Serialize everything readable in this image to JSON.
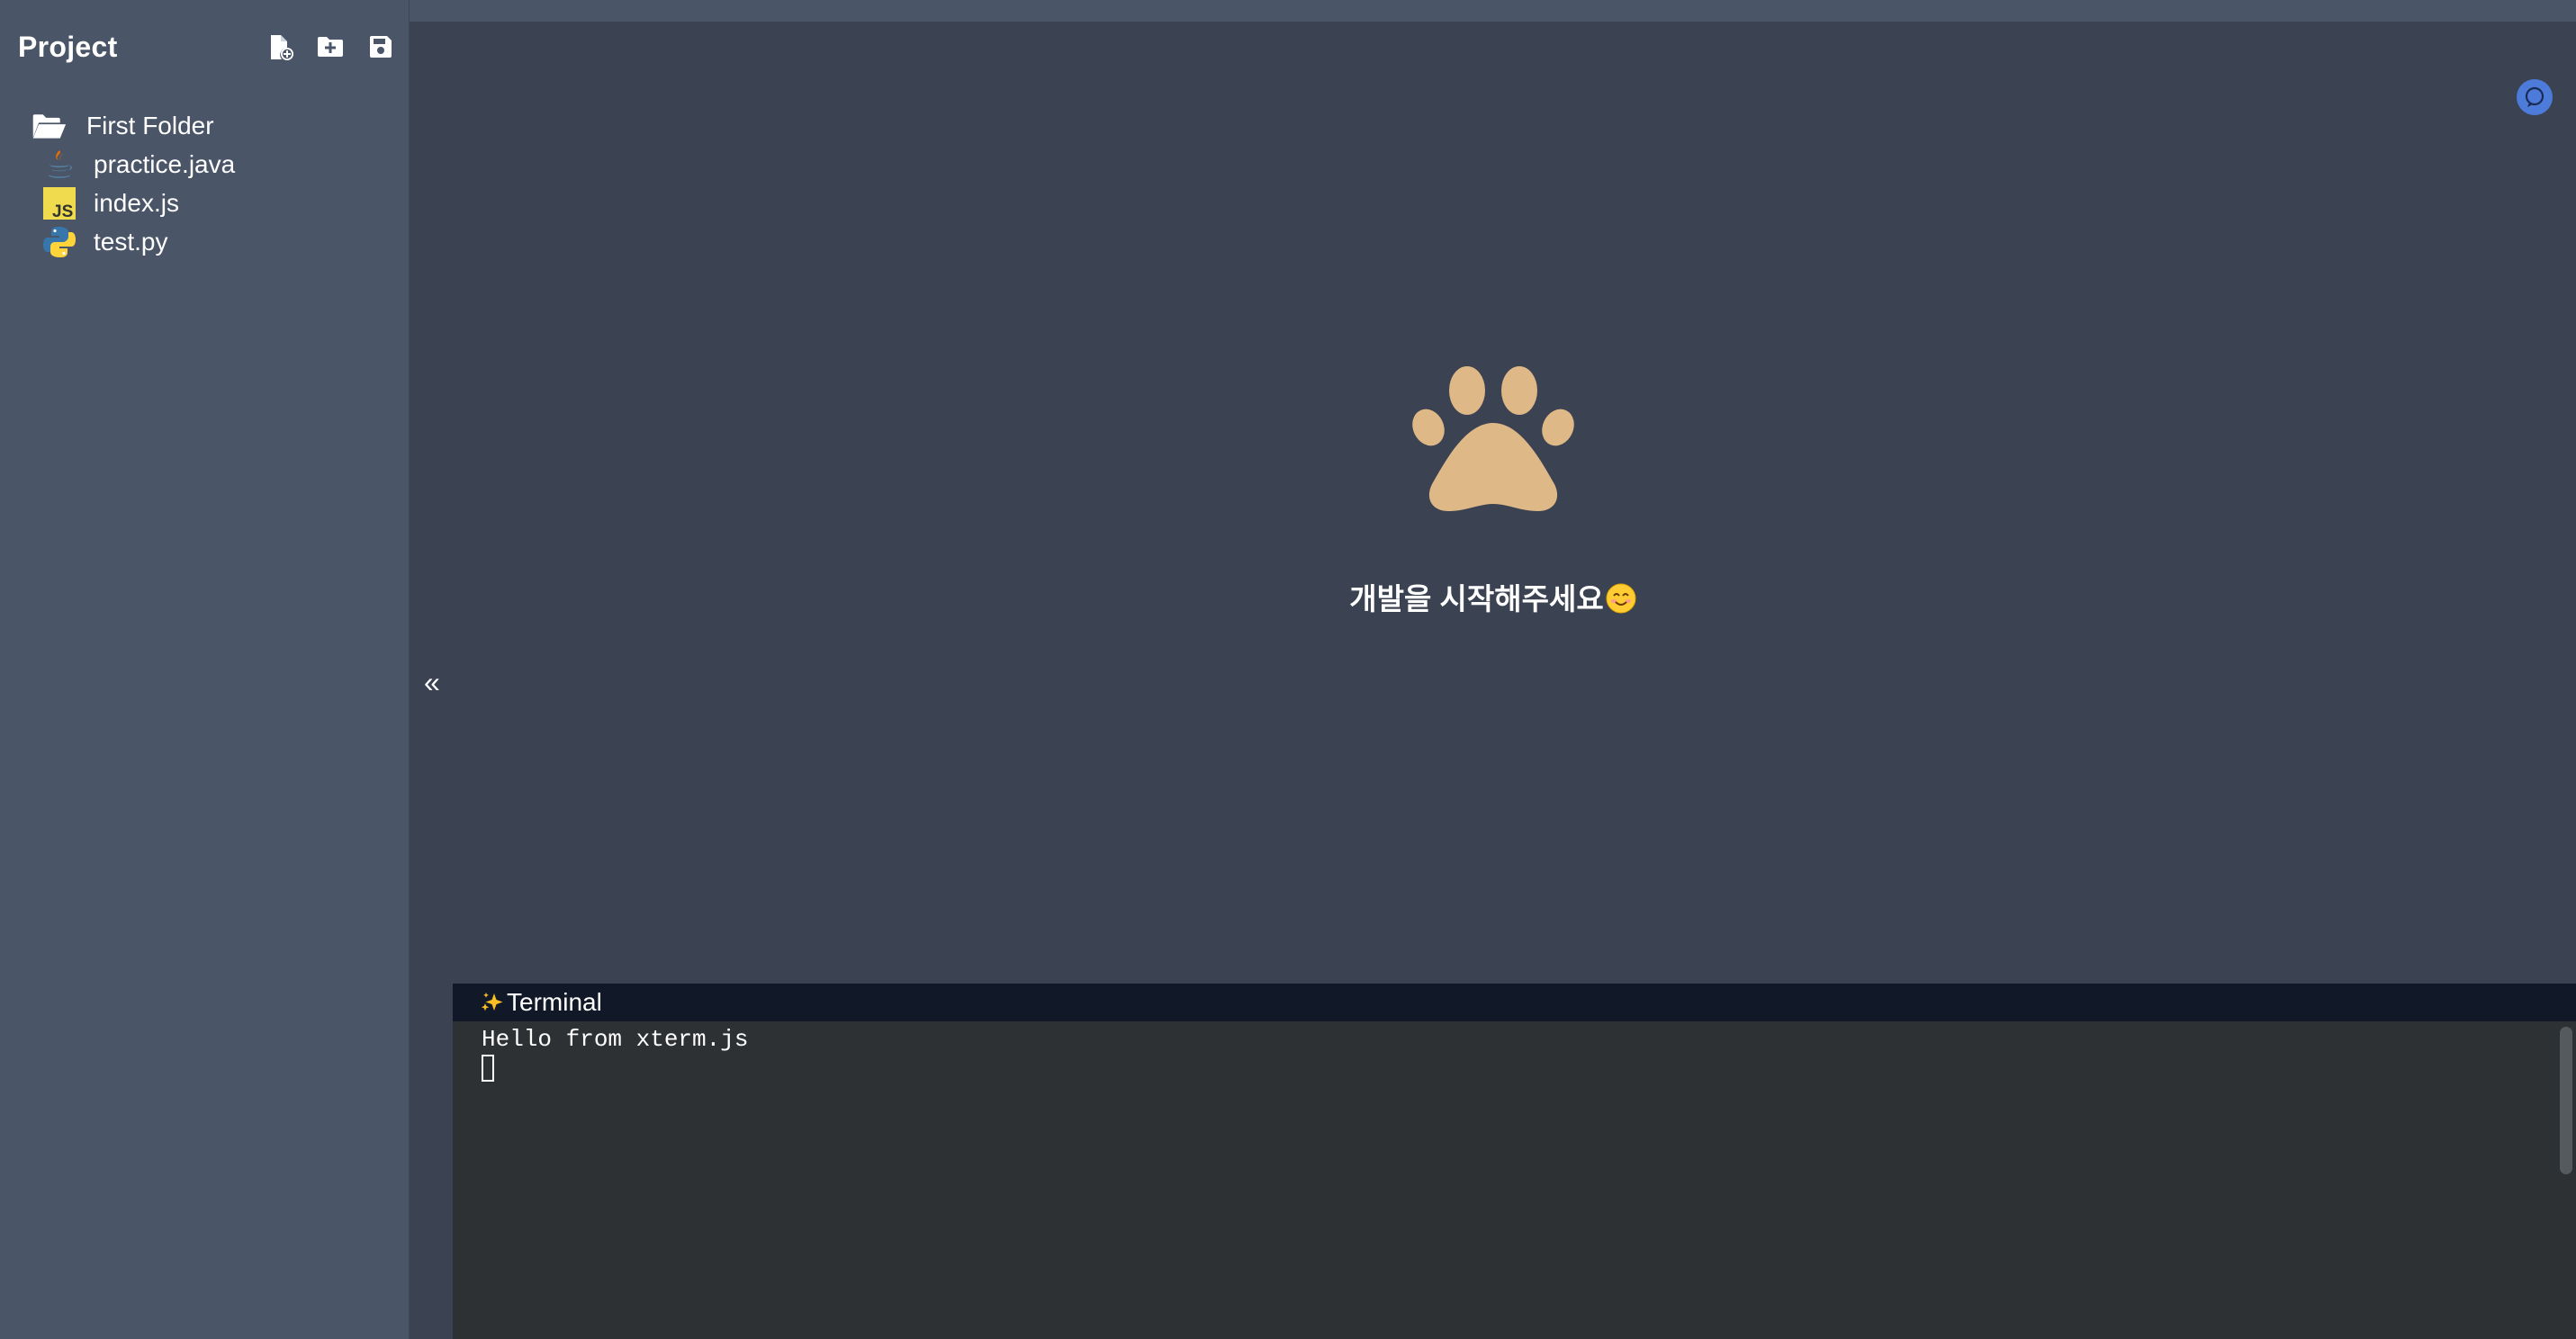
{
  "sidebar": {
    "title": "Project",
    "actions": [
      {
        "name": "new-file",
        "icon": "file-plus-icon"
      },
      {
        "name": "new-folder",
        "icon": "folder-plus-icon"
      },
      {
        "name": "save",
        "icon": "save-icon"
      }
    ],
    "tree": {
      "folder": {
        "label": "First Folder",
        "icon": "folder-open-icon"
      },
      "files": [
        {
          "label": "practice.java",
          "icon": "java-icon"
        },
        {
          "label": "index.js",
          "icon": "javascript-icon"
        },
        {
          "label": "test.py",
          "icon": "python-icon"
        }
      ]
    }
  },
  "main": {
    "collapse_label": "«",
    "welcome_text": "개발을 시작해주세요",
    "welcome_emoji": "smiling-face-icon",
    "paw_icon": "paw-icon",
    "paw_color": "#deb887",
    "chat_icon": "chat-icon"
  },
  "terminal": {
    "title": "Terminal",
    "title_icon": "sparkles-icon",
    "lines": [
      "Hello from xterm.js"
    ]
  },
  "colors": {
    "sidebar_bg": "#4a5568",
    "main_bg": "#3b4252",
    "terminal_header_bg": "#111827",
    "terminal_bg": "#2e3133",
    "accent": "#4c7bd9"
  }
}
